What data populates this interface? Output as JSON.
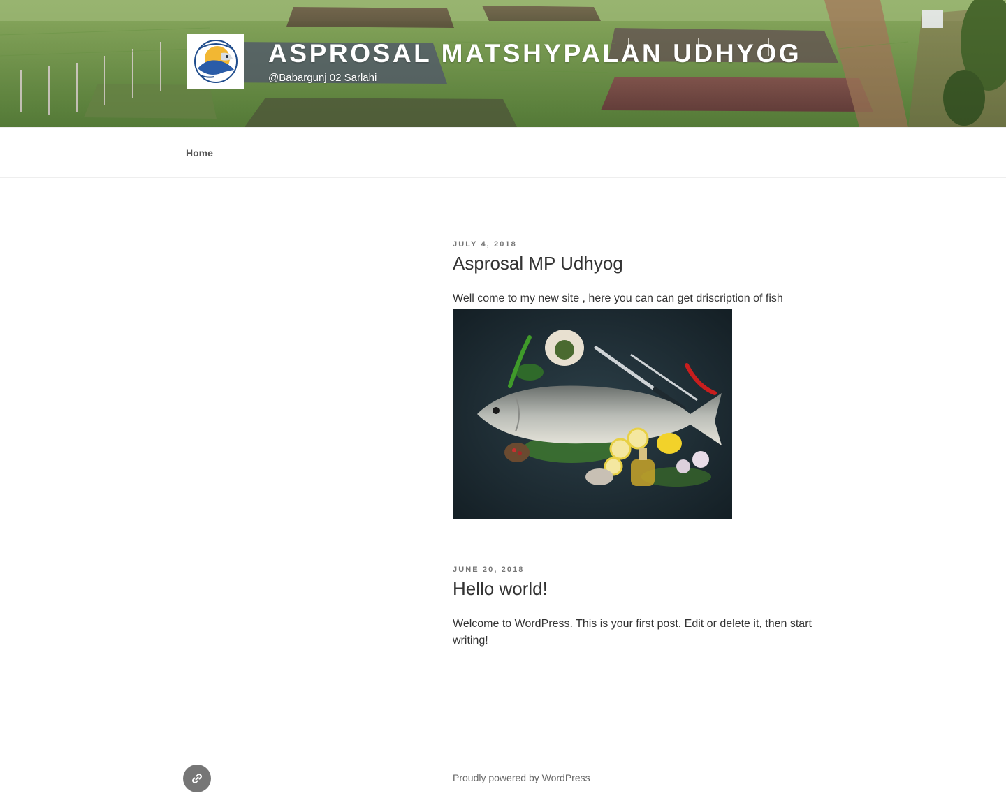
{
  "header": {
    "site_title": "Asprosal Matshypalan Udhyog",
    "tagline": "@Babargunj 02 Sarlahi"
  },
  "nav": {
    "items": [
      {
        "label": "Home"
      }
    ]
  },
  "posts": [
    {
      "date": "July 4, 2018",
      "title": "Asprosal MP Udhyog",
      "body": "Well come to my new site , here you can can get driscription of fish"
    },
    {
      "date": "June 20, 2018",
      "title": "Hello world!",
      "body": "Welcome to WordPress. This is your first post. Edit or delete it, then start writing!"
    }
  ],
  "footer": {
    "powered_by": "Proudly powered by WordPress",
    "social_icon": "link-icon"
  },
  "colors": {
    "accent_text": "#333333",
    "meta_gray": "#767676",
    "header_overlay_text": "#ffffff"
  }
}
